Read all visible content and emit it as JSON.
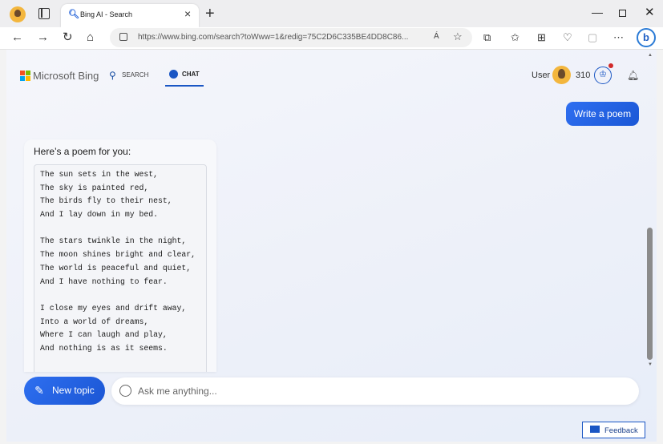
{
  "browser": {
    "tab_title": "Bing AI - Search",
    "tab_close": "×",
    "new_tab": "+",
    "url": "https://www.bing.com/search?toWww=1&redig=75C2D6C335BE4DD8C86...",
    "read_aloud": "Á",
    "window_controls": {
      "minimize": "—",
      "close": "✕"
    },
    "nav_icons": {
      "back": "←",
      "forward": "→",
      "refresh": "↻",
      "home": "⌂"
    },
    "toolbar_icons": [
      "puzzle-icon",
      "star-list-icon",
      "collections-icon",
      "health-icon",
      "share-icon",
      "more-icon"
    ]
  },
  "header": {
    "brand": "Microsoft Bing",
    "logo_colors": [
      "#f25022",
      "#7fba00",
      "#00a4ef",
      "#ffb900"
    ],
    "nav": {
      "search_label": "SEARCH",
      "chat_label": "CHAT"
    },
    "user_label": "User",
    "points": "310"
  },
  "chat": {
    "user_message": "Write a poem",
    "bot_intro": "Here’s a poem for you:",
    "poem_lines": [
      "The sun sets in the west,",
      "The sky is painted red,",
      "The birds fly to their nest,",
      "And I lay down in my bed.",
      "",
      "The stars twinkle in the night,",
      "The moon shines bright and clear,",
      "The world is peaceful and quiet,",
      "And I have nothing to fear.",
      "",
      "I close my eyes and drift away,",
      "Into a world of dreams,",
      "Where I can laugh and play,",
      "And nothing is as it seems."
    ]
  },
  "composer": {
    "new_topic_label": "New topic",
    "placeholder": "Ask me anything..."
  },
  "feedback_label": "Feedback",
  "colors": {
    "accent": "#1a56c4",
    "bubble": "#2f6ff0"
  }
}
